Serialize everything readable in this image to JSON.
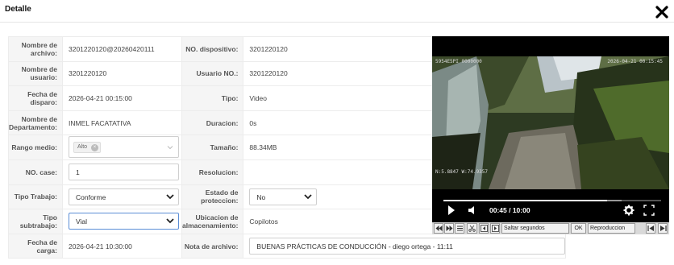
{
  "header": {
    "title": "Detalle",
    "close_icon": "close-icon"
  },
  "fields": {
    "nombre_archivo": {
      "label": "Nombre de archivo:",
      "value": "3201220120@20260420111"
    },
    "no_dispositivo": {
      "label": "NO. dispositivo:",
      "value": "3201220120"
    },
    "nombre_usuario": {
      "label": "Nombre de usuario:",
      "value": "3201220120"
    },
    "usuario_no": {
      "label": "Usuario NO.:",
      "value": "3201220120"
    },
    "fecha_disparo": {
      "label": "Fecha de disparo:",
      "value": "2026-04-21 00:15:00"
    },
    "tipo": {
      "label": "Tipo:",
      "value": "Video"
    },
    "nombre_departamento": {
      "label": "Nombre de Departamento:",
      "value": "INMEL FACATATIVA"
    },
    "duracion": {
      "label": "Duracion:",
      "value": "0s"
    },
    "rango_medio": {
      "label": "Rango medio:",
      "tag": "Alto"
    },
    "tamano": {
      "label": "Tamaño:",
      "value": "88.34MB"
    },
    "no_case": {
      "label": "NO. case:",
      "value": "1"
    },
    "resolucion": {
      "label": "Resolucion:",
      "value": ""
    },
    "tipo_trabajo": {
      "label": "Tipo Trabajo:",
      "selected": "Conforme"
    },
    "estado_proteccion": {
      "label": "Estado de proteccion:",
      "selected": "No"
    },
    "tipo_subtrabajo": {
      "label": "Tipo subtrabajo:",
      "selected": "Vial"
    },
    "ubicacion": {
      "label": "Ubicacion de almacenamiento:",
      "value": "Copilotos"
    },
    "fecha_carga": {
      "label": "Fecha de carga:",
      "value": "2026-04-21 10:30:00"
    },
    "nota_archivo": {
      "label": "Nota de archivo:",
      "value": "BUENAS PRÁCTICAS DE CONDUCCIÓN - diego ortega - 11:11"
    }
  },
  "player": {
    "osd_top_left": "5954E5PI 0000000",
    "osd_top_right": "2026-04-21 00:15:45",
    "osd_bottom_left": "N:5.8847 W:74.9357",
    "time_display": "00:45 / 10:00",
    "progress_fraction": 0.75,
    "buffered_fraction": 0.82,
    "icons": [
      "play-icon",
      "volume-icon",
      "settings-icon",
      "fullscreen-icon"
    ]
  },
  "toolbar": {
    "skip_label": "Saltar segundos",
    "ok_label": "OK",
    "speed_label": "Reproduccion"
  },
  "colors": {
    "focus_border": "#5b8ed6",
    "label_bg": "#f5f5f5"
  }
}
